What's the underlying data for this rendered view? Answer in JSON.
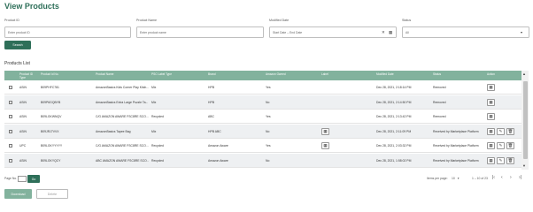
{
  "page": {
    "title": "View Products"
  },
  "filters": {
    "product_id": {
      "label": "Product ID",
      "placeholder": "Enter product ID"
    },
    "product_name": {
      "label": "Product Name",
      "placeholder": "Enter product name"
    },
    "modified_date": {
      "label": "Modified Date",
      "placeholder": "Start Date – End Date"
    },
    "status": {
      "label": "Status",
      "value": "All"
    },
    "search_label": "Search"
  },
  "list": {
    "title": "Products List",
    "columns": [
      "Product ID Type",
      "Product Id No.",
      "Product Name",
      "PSC Label Type",
      "Brand",
      "Amazon Owned",
      "Label",
      "Modified Date",
      "Status",
      "Action"
    ],
    "rows": [
      {
        "type": "ASIN",
        "id": "B09PHFC781",
        "name": "AmazonBasics Kids Corner Play Kitch...",
        "psc": "Mix",
        "brand": "HPB",
        "owned": "Yes",
        "label": "",
        "date": "Dec 28, 2021, 2:18:14 PM",
        "status": "Removed"
      },
      {
        "type": "ASIN",
        "id": "B09P6GQBYB",
        "name": "AmazonBasics Extra Large Puzzle Ta...",
        "psc": "Mix",
        "brand": "HPB",
        "owned": "No",
        "label": "",
        "date": "Dec 28, 2021, 2:14:50 PM",
        "status": "Removed"
      },
      {
        "type": "ASIN",
        "id": "B09LGKWNQV",
        "name": "C/G AMAZON AWARE FSC8RE SCO...",
        "psc": "Recycled",
        "brand": "ABC",
        "owned": "Yes",
        "label": "",
        "date": "Dec 28, 2021, 2:13:42 PM",
        "status": "Removed"
      },
      {
        "type": "ASIN",
        "id": "B09JRJ7VVX",
        "name": "AmazonBasics Tapee Bag",
        "psc": "Mix",
        "brand": "HPB ABC",
        "owned": "No",
        "label": "cal",
        "date": "Dec 28, 2021, 2:11:09 PM",
        "status": "Received by Marketplace Platform"
      },
      {
        "type": "UPC",
        "id": "B09LGKYYYYY",
        "name": "C/G AMAZON AWARE FSC8RE SCO...",
        "psc": "Recycled",
        "brand": "Amazon Aware",
        "owned": "Yes",
        "label": "cal",
        "date": "Dec 28, 2021, 2:03:32 PM",
        "status": "Received by Marketplace Platform"
      },
      {
        "type": "ASIN",
        "id": "B09LGKYQCY",
        "name": "ABC AMAZON AWARE FSC8RE SCO...",
        "psc": "Recycled",
        "brand": "Amazon Aware",
        "owned": "No",
        "label": "",
        "date": "Dec 28, 2021, 1:58:02 PM",
        "status": "Received by Marketplace Platform"
      }
    ]
  },
  "pagination": {
    "page_no_label": "Page No.",
    "go_label": "Go",
    "items_per_page_label": "Items per page:",
    "items_per_page_value": "10",
    "range": "1 – 10 of 23"
  },
  "footer": {
    "download_label": "Download",
    "delete_label": "Delete"
  },
  "icons": {
    "calendar": "calendar-icon",
    "edit": "edit-icon",
    "delete": "delete-icon",
    "label_calendar": "calendar-icon"
  },
  "colors": {
    "brand": "#2e6f59",
    "header": "#82b29d"
  }
}
